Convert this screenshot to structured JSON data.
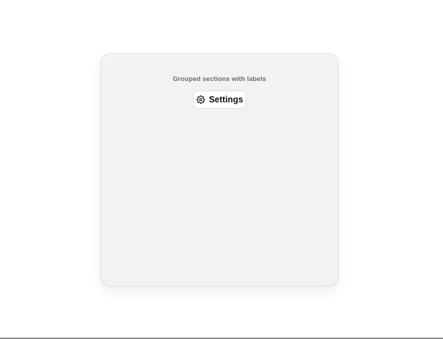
{
  "panel": {
    "caption": "Grouped sections with labels"
  },
  "settings_button": {
    "label": "Settings",
    "icon": "gear-icon"
  }
}
